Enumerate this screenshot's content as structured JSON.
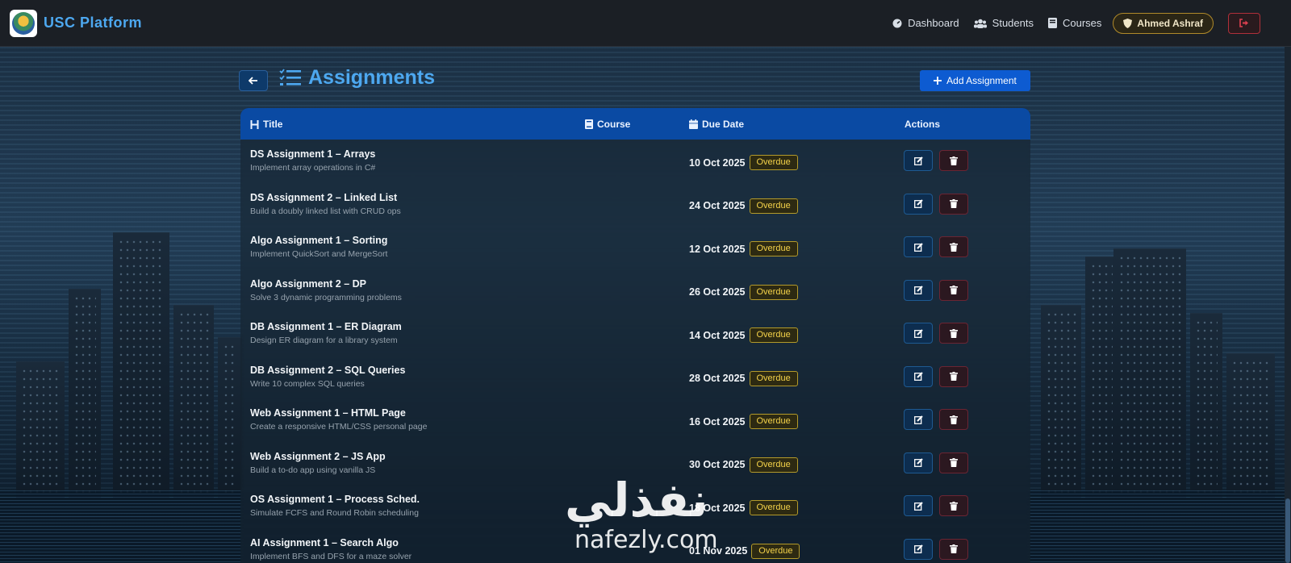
{
  "navbar": {
    "brand": "USC Platform",
    "links": [
      {
        "label": "Dashboard",
        "icon": "dashboard-icon"
      },
      {
        "label": "Students",
        "icon": "users-icon"
      },
      {
        "label": "Courses",
        "icon": "book-icon"
      }
    ],
    "user": "Ahmed Ashraf"
  },
  "page": {
    "title": "Assignments",
    "add_button": "Add Assignment"
  },
  "table": {
    "headers": {
      "title": "Title",
      "course": "Course",
      "due_date": "Due Date",
      "actions": "Actions"
    },
    "rows": [
      {
        "title": "DS Assignment 1 – Arrays",
        "desc": "Implement array operations in C#",
        "date": "10 Oct 2025",
        "status": "Overdue"
      },
      {
        "title": "DS Assignment 2 – Linked List",
        "desc": "Build a doubly linked list with CRUD ops",
        "date": "24 Oct 2025",
        "status": "Overdue"
      },
      {
        "title": "Algo Assignment 1 – Sorting",
        "desc": "Implement QuickSort and MergeSort",
        "date": "12 Oct 2025",
        "status": "Overdue"
      },
      {
        "title": "Algo Assignment 2 – DP",
        "desc": "Solve 3 dynamic programming problems",
        "date": "26 Oct 2025",
        "status": "Overdue"
      },
      {
        "title": "DB Assignment 1 – ER Diagram",
        "desc": "Design ER diagram for a library system",
        "date": "14 Oct 2025",
        "status": "Overdue"
      },
      {
        "title": "DB Assignment 2 – SQL Queries",
        "desc": "Write 10 complex SQL queries",
        "date": "28 Oct 2025",
        "status": "Overdue"
      },
      {
        "title": "Web Assignment 1 – HTML Page",
        "desc": "Create a responsive HTML/CSS personal page",
        "date": "16 Oct 2025",
        "status": "Overdue"
      },
      {
        "title": "Web Assignment 2 – JS App",
        "desc": "Build a to-do app using vanilla JS",
        "date": "30 Oct 2025",
        "status": "Overdue"
      },
      {
        "title": "OS Assignment 1 – Process Sched.",
        "desc": "Simulate FCFS and Round Robin scheduling",
        "date": "18 Oct 2025",
        "status": "Overdue"
      },
      {
        "title": "AI Assignment 1 – Search Algo",
        "desc": "Implement BFS and DFS for a maze solver",
        "date": "01 Nov 2025",
        "status": "Overdue"
      }
    ]
  },
  "watermark": {
    "arabic": "نفذلي",
    "latin": "nafezly.com"
  },
  "colors": {
    "accent": "#4da8f0",
    "header_bg": "#0a4aa3",
    "badge": "#f5d34a",
    "primary_button": "#0d5bd1"
  }
}
